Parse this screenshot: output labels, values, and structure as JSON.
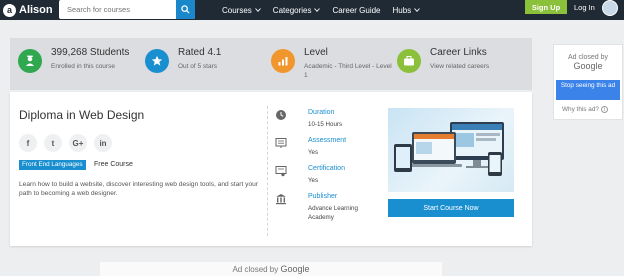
{
  "header": {
    "logo_mark": "a",
    "logo_text": "Alison",
    "search_placeholder": "Search for courses",
    "nav": [
      {
        "label": "Courses"
      },
      {
        "label": "Categories"
      },
      {
        "label": "Career Guide"
      },
      {
        "label": "Hubs"
      }
    ],
    "signup_label": "Sign Up",
    "login_label": "Log In"
  },
  "stats": [
    {
      "title": "399,268 Students",
      "sub": "Enrolled in this course",
      "icon": "graduate-icon",
      "color": "#2fa84f"
    },
    {
      "title": "Rated 4.1",
      "sub": "Out of 5 stars",
      "icon": "star-icon",
      "color": "#1a8fd0"
    },
    {
      "title": "Level",
      "sub": "Academic - Third Level - Level 1",
      "icon": "chart-icon",
      "color": "#f0962d"
    },
    {
      "title": "Career Links",
      "sub": "View related careers",
      "icon": "briefcase-icon",
      "color": "#8bc03b"
    }
  ],
  "course": {
    "title": "Diploma in Web Design",
    "social": [
      "f",
      "t",
      "G+",
      "in"
    ],
    "tag": "Front End Languages",
    "price_label": "Free Course",
    "description": "Learn how to build a website, discover interesting web design tools, and start your path to becoming a web designer."
  },
  "meta": [
    {
      "label": "Duration",
      "value": "10-15 Hours",
      "icon": "clock-icon"
    },
    {
      "label": "Assessment",
      "value": "Yes",
      "icon": "assessment-icon"
    },
    {
      "label": "Certification",
      "value": "Yes",
      "icon": "certificate-icon"
    },
    {
      "label": "Publisher",
      "value": "Advance Learning Academy",
      "icon": "building-icon"
    }
  ],
  "cta": {
    "start_label": "Start Course Now"
  },
  "ad_right": {
    "closed_by": "Ad closed by",
    "google": "Google",
    "stop_label": "Stop seeing this ad",
    "why_label": "Why this ad?"
  },
  "ad_bottom": {
    "closed_by": "Ad closed by",
    "google": "Google"
  },
  "colors": {
    "nav_bg": "#1f2a35",
    "accent": "#1a8fd0",
    "signup": "#8bc03b"
  }
}
